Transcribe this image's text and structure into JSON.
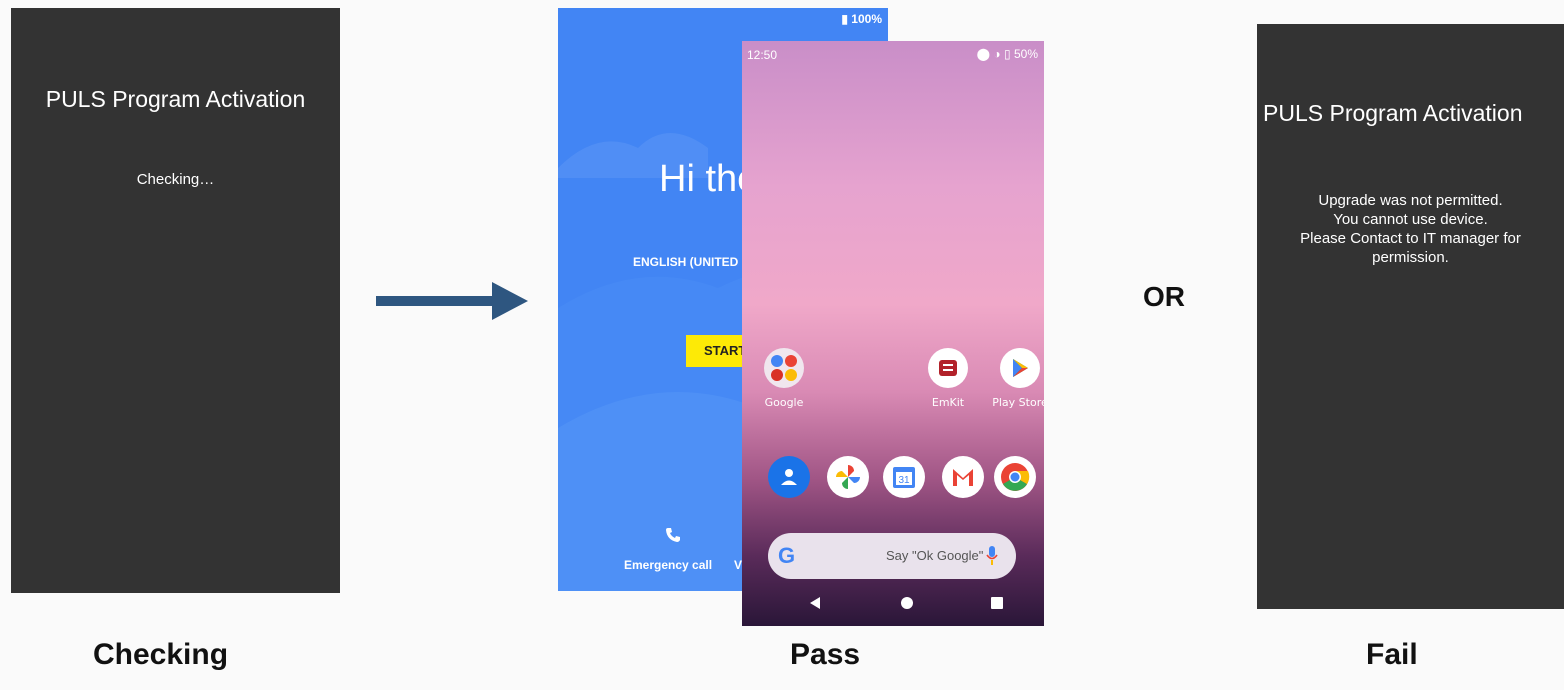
{
  "checking": {
    "title": "PULS Program Activation",
    "message": "Checking…",
    "caption": "Checking"
  },
  "pass": {
    "caption": "Pass",
    "setup": {
      "battery": "100%",
      "greeting": "Hi the",
      "language": "ENGLISH (UNITED S",
      "start_button": "START",
      "emergency_call": "Emergency call",
      "partial_link": "V"
    },
    "home": {
      "time": "12:50",
      "battery": "50%",
      "apps": [
        {
          "label": "Google",
          "icon": "google-folder-icon"
        },
        {
          "label": "EmKit",
          "icon": "emkit-icon"
        },
        {
          "label": "Play Store",
          "icon": "play-store-icon"
        }
      ],
      "dock": [
        "contacts-icon",
        "photos-icon",
        "calendar-icon",
        "gmail-icon",
        "chrome-icon"
      ],
      "calendar_day": "31",
      "search_placeholder": "Say \"Ok Google\""
    }
  },
  "or_label": "OR",
  "fail": {
    "title": "PULS Program Activation",
    "message_lines": [
      "Upgrade was not permitted.",
      "You cannot use device.",
      "Please Contact to IT manager for",
      "permission."
    ],
    "caption": "Fail"
  },
  "colors": {
    "dark_screen": "#333333",
    "setup_blue": "#4285f4",
    "start_yellow": "#fdea06",
    "arrow": "#2e5680"
  }
}
